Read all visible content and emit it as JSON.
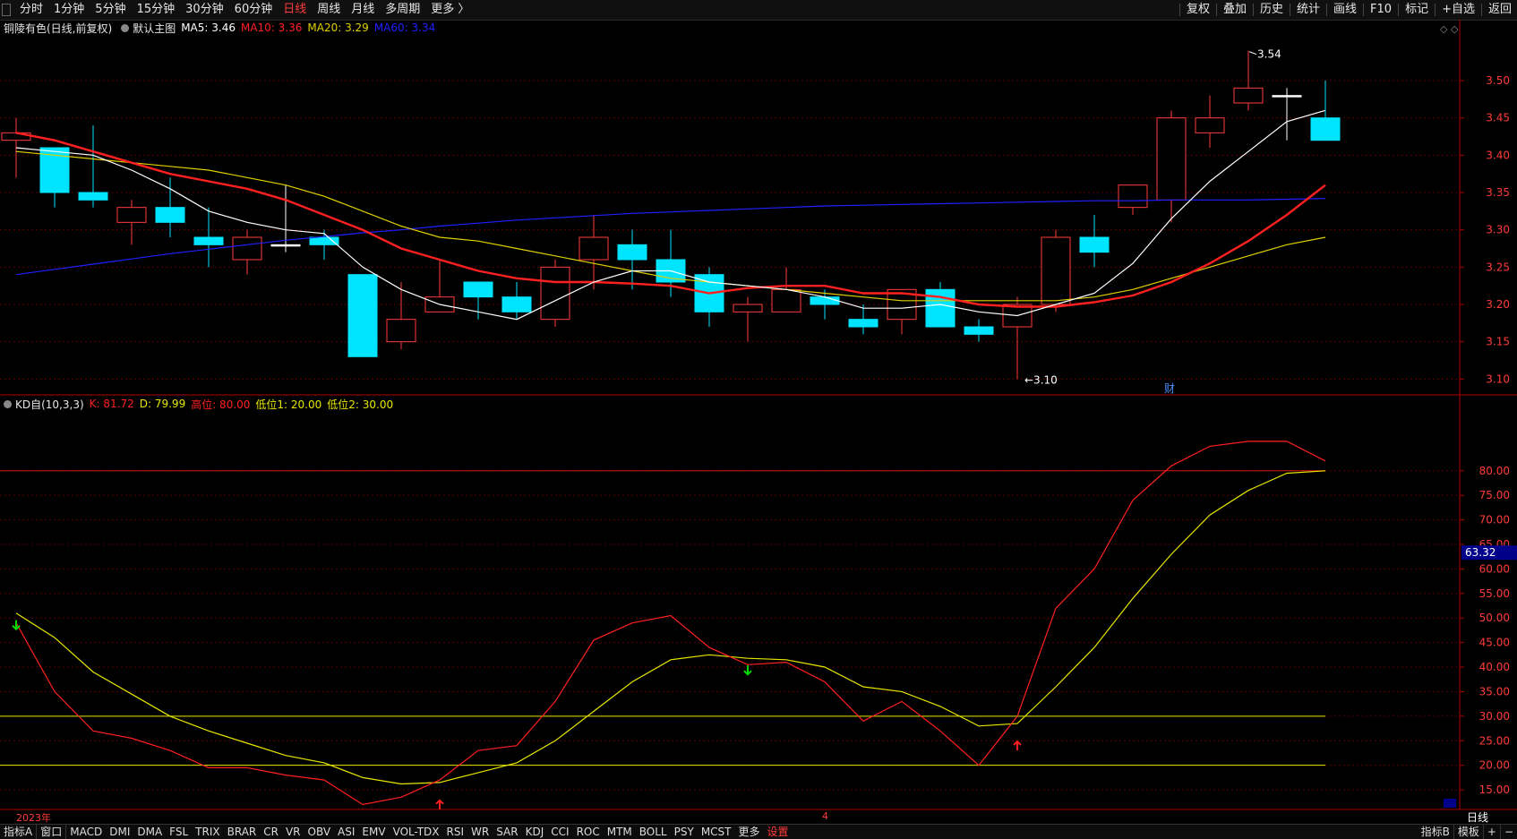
{
  "toolbar": {
    "periods": [
      "分时",
      "1分钟",
      "5分钟",
      "15分钟",
      "30分钟",
      "60分钟",
      "日线",
      "周线",
      "月线",
      "多周期",
      "更多 〉"
    ],
    "active_period": "日线",
    "right_buttons": [
      "复权",
      "叠加",
      "历史",
      "统计",
      "画线",
      "F10",
      "标记",
      "+自选",
      "返回"
    ]
  },
  "main_info": {
    "stock": "铜陵有色(日线,前复权)",
    "template": "默认主图",
    "ma5": "MA5: 3.46",
    "ma10": "MA10: 3.36",
    "ma20": "MA20: 3.29",
    "ma60": "MA60: 3.34"
  },
  "kd_info": {
    "name": "KD自(10,3,3)",
    "k": "K: 81.72",
    "d": "D: 79.99",
    "high": "高位: 80.00",
    "low1": "低位1: 20.00",
    "low2": "低位2: 30.00"
  },
  "annotations": {
    "high_mark": "3.54",
    "low_mark": "3.10",
    "cai": "财",
    "current_value": "63.32"
  },
  "dates": {
    "year": "2023年",
    "month": "4"
  },
  "bottom": {
    "tabs": [
      "指标A",
      "窗口"
    ],
    "indicators": [
      "MACD",
      "DMI",
      "DMA",
      "FSL",
      "TRIX",
      "BRAR",
      "CR",
      "VR",
      "OBV",
      "ASI",
      "EMV",
      "VOL-TDX",
      "RSI",
      "WR",
      "SAR",
      "KDJ",
      "CCI",
      "ROC",
      "MTM",
      "BOLL",
      "PSY",
      "MCST",
      "更多"
    ],
    "settings": "设置",
    "right_tabs": [
      "指标B",
      "模板"
    ],
    "period_label": "日线"
  },
  "colors": {
    "up": "#ff3b3b",
    "down": "#00e5ff",
    "ma5": "#ffffff",
    "ma10": "#ff2020",
    "ma20": "#e0d000",
    "ma60": "#2020ff",
    "k_line": "#ff2020",
    "d_line": "#e6e600"
  },
  "price_axis": {
    "ticks": [
      3.1,
      3.15,
      3.2,
      3.25,
      3.3,
      3.35,
      3.4,
      3.45,
      3.5
    ],
    "min": 3.08,
    "max": 3.56
  },
  "kd_axis": {
    "ticks": [
      15,
      20,
      25,
      30,
      35,
      40,
      45,
      50,
      55,
      60,
      65,
      70,
      75,
      80
    ],
    "min": 11,
    "max": 92
  },
  "chart_data": {
    "type": "candlestick",
    "candles": [
      {
        "o": 3.42,
        "h": 3.45,
        "l": 3.37,
        "c": 3.43
      },
      {
        "o": 3.41,
        "h": 3.41,
        "l": 3.33,
        "c": 3.35
      },
      {
        "o": 3.35,
        "h": 3.44,
        "l": 3.33,
        "c": 3.34
      },
      {
        "o": 3.31,
        "h": 3.34,
        "l": 3.28,
        "c": 3.33
      },
      {
        "o": 3.33,
        "h": 3.37,
        "l": 3.29,
        "c": 3.31
      },
      {
        "o": 3.29,
        "h": 3.33,
        "l": 3.25,
        "c": 3.28
      },
      {
        "o": 3.26,
        "h": 3.3,
        "l": 3.24,
        "c": 3.29
      },
      {
        "o": 3.28,
        "h": 3.36,
        "l": 3.27,
        "c": 3.28
      },
      {
        "o": 3.29,
        "h": 3.3,
        "l": 3.26,
        "c": 3.28
      },
      {
        "o": 3.24,
        "h": 3.24,
        "l": 3.13,
        "c": 3.13
      },
      {
        "o": 3.15,
        "h": 3.23,
        "l": 3.14,
        "c": 3.18
      },
      {
        "o": 3.19,
        "h": 3.26,
        "l": 3.19,
        "c": 3.21
      },
      {
        "o": 3.23,
        "h": 3.23,
        "l": 3.18,
        "c": 3.21
      },
      {
        "o": 3.21,
        "h": 3.23,
        "l": 3.18,
        "c": 3.19
      },
      {
        "o": 3.18,
        "h": 3.26,
        "l": 3.17,
        "c": 3.25
      },
      {
        "o": 3.26,
        "h": 3.32,
        "l": 3.22,
        "c": 3.29
      },
      {
        "o": 3.28,
        "h": 3.3,
        "l": 3.22,
        "c": 3.26
      },
      {
        "o": 3.26,
        "h": 3.3,
        "l": 3.21,
        "c": 3.23
      },
      {
        "o": 3.24,
        "h": 3.25,
        "l": 3.17,
        "c": 3.19
      },
      {
        "o": 3.19,
        "h": 3.21,
        "l": 3.15,
        "c": 3.2
      },
      {
        "o": 3.19,
        "h": 3.25,
        "l": 3.19,
        "c": 3.22
      },
      {
        "o": 3.21,
        "h": 3.22,
        "l": 3.18,
        "c": 3.2
      },
      {
        "o": 3.18,
        "h": 3.2,
        "l": 3.16,
        "c": 3.17
      },
      {
        "o": 3.18,
        "h": 3.22,
        "l": 3.16,
        "c": 3.22
      },
      {
        "o": 3.22,
        "h": 3.23,
        "l": 3.17,
        "c": 3.17
      },
      {
        "o": 3.17,
        "h": 3.18,
        "l": 3.15,
        "c": 3.16
      },
      {
        "o": 3.17,
        "h": 3.21,
        "l": 3.1,
        "c": 3.2
      },
      {
        "o": 3.2,
        "h": 3.3,
        "l": 3.19,
        "c": 3.29
      },
      {
        "o": 3.29,
        "h": 3.32,
        "l": 3.25,
        "c": 3.27
      },
      {
        "o": 3.33,
        "h": 3.36,
        "l": 3.32,
        "c": 3.36
      },
      {
        "o": 3.34,
        "h": 3.46,
        "l": 3.31,
        "c": 3.45
      },
      {
        "o": 3.43,
        "h": 3.48,
        "l": 3.41,
        "c": 3.45
      },
      {
        "o": 3.47,
        "h": 3.54,
        "l": 3.46,
        "c": 3.49
      },
      {
        "o": 3.48,
        "h": 3.49,
        "l": 3.42,
        "c": 3.48
      },
      {
        "o": 3.45,
        "h": 3.5,
        "l": 3.42,
        "c": 3.42
      }
    ],
    "ma5": [
      3.41,
      3.405,
      3.4,
      3.38,
      3.355,
      3.325,
      3.31,
      3.3,
      3.295,
      3.25,
      3.22,
      3.2,
      3.19,
      3.18,
      3.205,
      3.23,
      3.245,
      3.245,
      3.23,
      3.225,
      3.22,
      3.21,
      3.195,
      3.195,
      3.2,
      3.19,
      3.185,
      3.2,
      3.215,
      3.255,
      3.315,
      3.365,
      3.405,
      3.445,
      3.46
    ],
    "ma10": [
      3.43,
      3.42,
      3.405,
      3.39,
      3.375,
      3.365,
      3.355,
      3.34,
      3.32,
      3.3,
      3.275,
      3.26,
      3.245,
      3.235,
      3.23,
      3.23,
      3.228,
      3.225,
      3.215,
      3.222,
      3.225,
      3.225,
      3.215,
      3.215,
      3.21,
      3.2,
      3.197,
      3.197,
      3.203,
      3.212,
      3.23,
      3.255,
      3.285,
      3.32,
      3.36
    ],
    "ma20": [
      3.405,
      3.4,
      3.395,
      3.39,
      3.385,
      3.38,
      3.37,
      3.36,
      3.345,
      3.325,
      3.305,
      3.29,
      3.285,
      3.275,
      3.265,
      3.255,
      3.245,
      3.235,
      3.23,
      3.225,
      3.22,
      3.215,
      3.21,
      3.205,
      3.205,
      3.205,
      3.205,
      3.205,
      3.21,
      3.22,
      3.235,
      3.25,
      3.265,
      3.28,
      3.29
    ],
    "ma60": [
      3.24,
      3.247,
      3.254,
      3.261,
      3.268,
      3.274,
      3.28,
      3.286,
      3.291,
      3.296,
      3.3,
      3.305,
      3.309,
      3.313,
      3.316,
      3.319,
      3.322,
      3.324,
      3.326,
      3.328,
      3.33,
      3.332,
      3.333,
      3.334,
      3.335,
      3.336,
      3.337,
      3.338,
      3.339,
      3.339,
      3.34,
      3.34,
      3.34,
      3.341,
      3.342
    ],
    "k": [
      49,
      35,
      27,
      25.5,
      23,
      19.5,
      19.5,
      18,
      17,
      12,
      13.5,
      17,
      23,
      24,
      33,
      45.5,
      49,
      50.5,
      44,
      40.5,
      41,
      37,
      29,
      33,
      27,
      20,
      30,
      52,
      60,
      74,
      81,
      85,
      86,
      86,
      82
    ],
    "d": [
      51,
      46,
      39,
      34.5,
      30,
      27,
      24.5,
      22,
      20.5,
      17.5,
      16.2,
      16.5,
      18.5,
      20.5,
      25,
      31,
      37,
      41.5,
      42.5,
      41.8,
      41.5,
      40,
      36,
      35,
      32,
      28,
      28.5,
      36,
      44,
      54,
      63,
      71,
      76,
      79.5,
      80
    ],
    "markers": [
      {
        "index": 0,
        "type": "down_arrow",
        "color": "green"
      },
      {
        "index": 11,
        "type": "up_arrow",
        "color": "red"
      },
      {
        "index": 19,
        "type": "down_arrow",
        "color": "green"
      },
      {
        "index": 26,
        "type": "up_arrow",
        "color": "red"
      }
    ],
    "hlines": [
      {
        "value": 80,
        "color": "red"
      },
      {
        "value": 30,
        "color": "yellow"
      },
      {
        "value": 20,
        "color": "yellow"
      }
    ]
  }
}
